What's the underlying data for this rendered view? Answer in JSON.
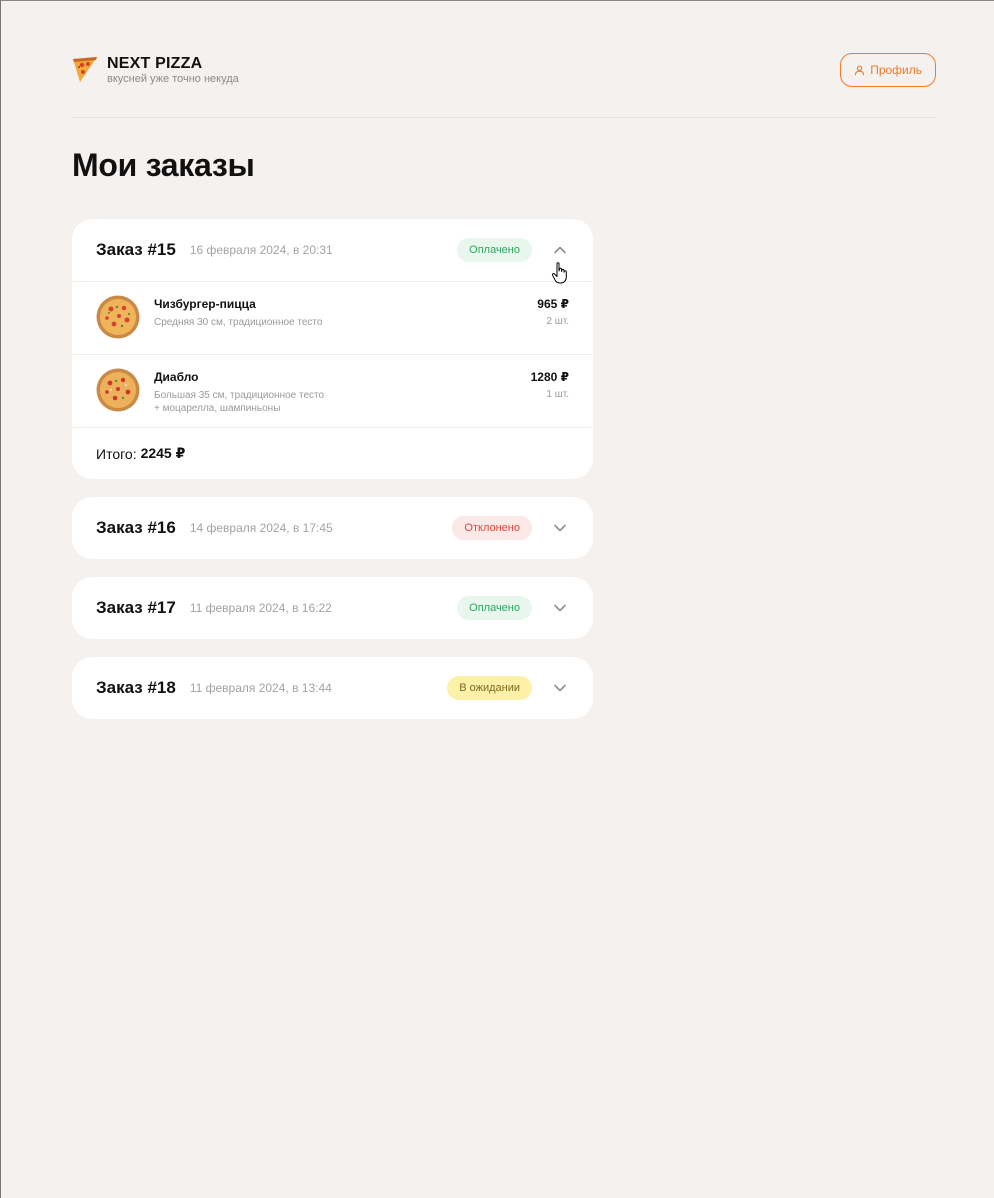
{
  "header": {
    "brand_title": "NEXT PIZZA",
    "brand_subtitle": "вкусней уже точно некуда",
    "profile_label": "Профиль"
  },
  "page_title": "Мои заказы",
  "currency": "₽",
  "colors": {
    "accent": "#f07a2a",
    "paid": "#2da55f",
    "rejected": "#e0463c",
    "pending": "#fdf0a8"
  },
  "orders": [
    {
      "title": "Заказ #15",
      "date": "16 февраля 2024, в 20:31",
      "status": "Оплачено",
      "expanded": true,
      "items": [
        {
          "name": "Чизбургер-пицца",
          "desc1": "Средняя 30 см, традиционное тесто",
          "desc2": "",
          "price": "965 ₽",
          "qty": "2 шт."
        },
        {
          "name": "Диабло",
          "desc1": "Большая 35 см, традиционное тесто",
          "desc2": "+ моцарелла, шампиньоны",
          "price": "1280 ₽",
          "qty": "1 шт."
        }
      ],
      "total_label": "Итого:",
      "total_value": "2245 ₽"
    },
    {
      "title": "Заказ #16",
      "date": "14 февраля 2024, в 17:45",
      "status": "Отклонено",
      "expanded": false
    },
    {
      "title": "Заказ #17",
      "date": "11 февраля 2024, в 16:22",
      "status": "Оплачено",
      "expanded": false
    },
    {
      "title": "Заказ #18",
      "date": "11 февраля 2024, в 13:44",
      "status": "В ожидании",
      "expanded": false
    }
  ]
}
